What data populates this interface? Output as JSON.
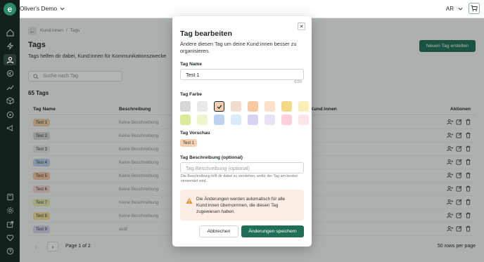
{
  "topbar": {
    "workspace": "Oliver's Demo",
    "lang": "AR"
  },
  "breadcrumb": [
    "Kund:innen",
    "/",
    "Tags"
  ],
  "page": {
    "title": "Tags",
    "description": "Tags helfen dir dabei, Kund:innen für Kommunikationszwecke",
    "new_button": "Neuen Tag erstellen",
    "search_placeholder": "Suche nach Tag",
    "count": "65 Tags"
  },
  "table": {
    "headers": {
      "name": "Tag Name",
      "description": "Beschreibung",
      "customers": "Kund:innen",
      "actions": "Aktionen"
    },
    "rows": [
      {
        "name": "Test 1",
        "description": "Keine Beschreibung",
        "color": "#f0cfa9"
      },
      {
        "name": "Test 2",
        "description": "Keine Beschreibung",
        "color": "#d6d6d6"
      },
      {
        "name": "Test 3",
        "description": "Keine Beschreibung",
        "color": "#e6e7e6"
      },
      {
        "name": "Test 4",
        "description": "Keine Beschreibung",
        "color": "#bcd2ef"
      },
      {
        "name": "Test 5",
        "description": "Keine Beschreibung",
        "color": "#f6c7a8"
      },
      {
        "name": "Test 6",
        "description": "Keine Beschreibung",
        "color": "#f3d9d6"
      },
      {
        "name": "Test 7",
        "description": "Keine Beschreibung",
        "color": "#e6edb0"
      },
      {
        "name": "Test 8",
        "description": "Keine Beschreibung",
        "color": "#f2df9a"
      },
      {
        "name": "Test 9",
        "description": "asdf",
        "color": "#d9d4f0"
      }
    ]
  },
  "pager": {
    "page_text": "Page 1 of 2",
    "rows_per_page": "50 rows per page"
  },
  "modal": {
    "title": "Tag bearbeiten",
    "subtitle": "Ändere diesen Tag um deine Kund:innen besser zu organisieren.",
    "name_label": "Tag Name",
    "name_value": "Test 1",
    "char_count": "6/20",
    "color_label": "Tag Farbe",
    "colors": [
      "#d7d7d7",
      "#e8e8e8",
      "#f2cfb0",
      "#f2dccd",
      "#f9c9a3",
      "#fde0cc",
      "#f3d98a",
      "#fcedb9",
      "#d9ea9a",
      "#eef4ce",
      "#bcd2ef",
      "#dbe9fb",
      "#d8d2f3",
      "#e7e2f5",
      "#fbd0da",
      "#fde3ea"
    ],
    "selected_color_index": 2,
    "preview_label": "Tag Vorschau",
    "preview_value": "Test 1",
    "desc_label": "Tag Beschreibung (optional)",
    "desc_placeholder": "Tag Beschreibung (optional)",
    "hint": "Die Beschreibung hilft dir dabei zu verstehen, wofür der Tag am besten verwendet wird.",
    "warning": "Die Änderungen werden automatisch für alle Kund:innen übernommen, die diesen Tag zugewiesen haben.",
    "cancel": "Abbrechen",
    "save": "Änderungen speichern"
  }
}
